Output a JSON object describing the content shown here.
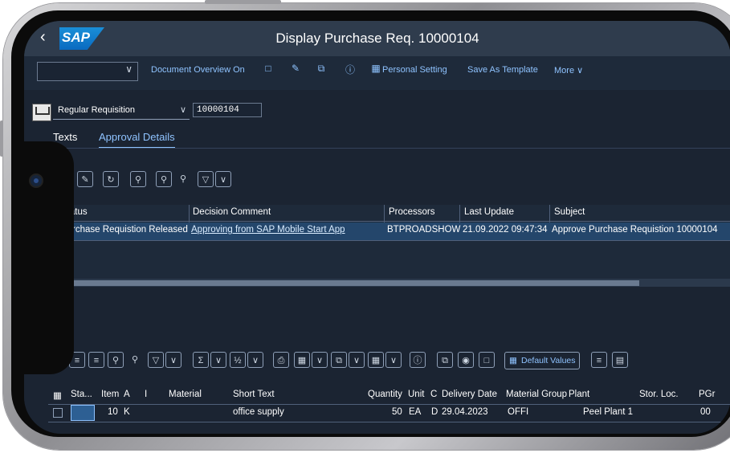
{
  "header": {
    "back": "‹",
    "logo": "SAP",
    "title": "Display Purchase Req. 10000104"
  },
  "toolbar": {
    "document_overview": "Document Overview On",
    "personal_setting": "Personal Setting",
    "save_as_template": "Save As Template",
    "more": "More"
  },
  "requisition": {
    "type": "Regular Requisition",
    "number": "10000104"
  },
  "tabs": [
    {
      "label": "Texts"
    },
    {
      "label": "Approval Details"
    }
  ],
  "approval": {
    "columns": [
      "Status",
      "Decision Comment",
      "Processors",
      "Last Update",
      "Subject"
    ],
    "row": {
      "status": "Purchase Requistion Released",
      "comment": "Approving from SAP Mobile Start App",
      "processor": "BTPROADSHOW",
      "last_update": "21.09.2022 09:47:34",
      "subject": "Approve Purchase Requistion 10000104"
    }
  },
  "items": {
    "default_values": "Default Values",
    "columns": {
      "status": "Sta...",
      "item": "Item",
      "a": "A",
      "i": "I",
      "material": "Material",
      "short_text": "Short Text",
      "quantity": "Quantity",
      "unit": "Unit",
      "c": "C",
      "delivery_date": "Delivery Date",
      "material_group": "Material Group",
      "plant": "Plant",
      "stor_loc": "Stor. Loc.",
      "pgr": "PGr"
    },
    "row": {
      "item": "10",
      "a": "K",
      "short_text": "office supply",
      "quantity": "50",
      "unit": "EA",
      "c": "D",
      "delivery_date": "29.04.2023",
      "material_group": "OFFI",
      "plant": "Peel Plant 1",
      "pgr": "00"
    }
  },
  "colors": {
    "header": "#2f3c4d",
    "background": "#1b2432",
    "link": "#8fc3ff",
    "selected_row": "#24466b"
  }
}
